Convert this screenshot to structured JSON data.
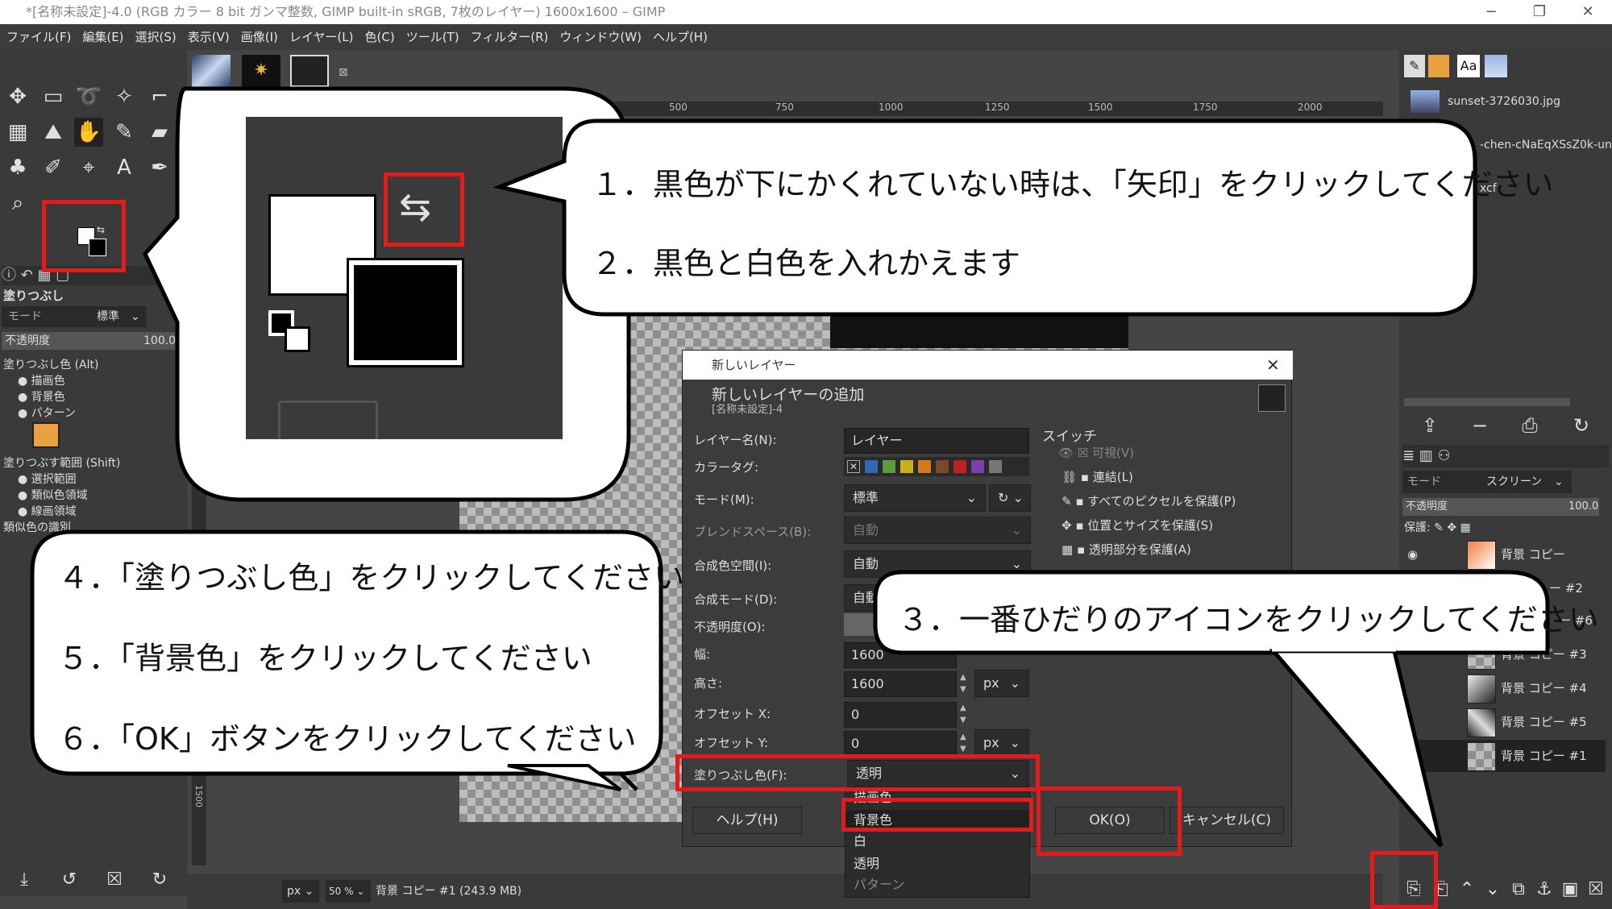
{
  "window": {
    "title": "*[名称未設定]-4.0 (RGB カラー 8 bit ガンマ整数, GIMP built-in sRGB, 7枚のレイヤー) 1600x1600 – GIMP",
    "controls": [
      "−",
      "❐",
      "✕"
    ]
  },
  "menu": [
    "ファイル(F)",
    "編集(E)",
    "選択(S)",
    "表示(V)",
    "画像(I)",
    "レイヤー(L)",
    "色(C)",
    "ツール(T)",
    "フィルター(R)",
    "ウィンドウ(W)",
    "ヘルプ(H)"
  ],
  "toolOptions": {
    "title": "塗りつぶし",
    "mode_label": "モード",
    "mode_value": "標準",
    "opacity_label": "不透明度",
    "opacity_value": "100.0",
    "fillcolor_label": "塗りつぶし色 (Alt)",
    "fill_options": [
      "描画色",
      "背景色",
      "パターン"
    ],
    "area_label": "塗りつぶす範囲 (Shift)",
    "area_options": [
      "選択範囲",
      "類似色領域",
      "線画領域"
    ],
    "similar_label": "類似色の識別"
  },
  "ruler": {
    "ticks": [
      "500",
      "750",
      "1000",
      "1250",
      "1500",
      "1750",
      "2000"
    ],
    "side": "1500"
  },
  "status": {
    "unit": "px",
    "zoom": "50 %",
    "layer_info": "背景 コピー #1 (243.9 MB)"
  },
  "rightPanel": {
    "images": [
      "sunset-3726030.jpg",
      "-chen-cNaEqXSsZ0k-unsp",
      "xcf"
    ],
    "layers_mode_label": "モード",
    "layers_mode_value": "スクリーン",
    "opacity_label": "不透明度",
    "opacity_value": "100.0",
    "lock_label": "保護:",
    "layers": [
      "背景 コピー",
      "ー #2",
      "ー #6",
      "背景 コピー #3",
      "背景 コピー #4",
      "背景 コピー #5",
      "背景 コピー #1"
    ]
  },
  "dialog": {
    "title": "新しいレイヤー",
    "heading": "新しいレイヤーの追加",
    "subheading": "[名称未設定]-4",
    "layer_name_label": "レイヤー名(N):",
    "layer_name_value": "レイヤー",
    "color_tag_label": "カラータグ:",
    "mode_label": "モード(M):",
    "mode_value": "標準",
    "blend_space_label": "ブレンドスペース(B):",
    "blend_space_value": "自動",
    "composite_space_label": "合成色空間(I):",
    "composite_space_value": "自動",
    "composite_mode_label": "合成モード(D):",
    "composite_mode_value": "自動",
    "opacity_label": "不透明度(O):",
    "width_label": "幅:",
    "width_value": "1600",
    "height_label": "高さ:",
    "height_value": "1600",
    "offset_x_label": "オフセット X:",
    "offset_x_value": "0",
    "offset_y_label": "オフセット Y:",
    "offset_y_value": "0",
    "unit": "px",
    "fill_label": "塗りつぶし色(F):",
    "fill_value": "透明",
    "fill_dropdown": [
      "描画色",
      "背景色",
      "白",
      "透明",
      "パターン"
    ],
    "switch_title": "スイッチ",
    "switches": [
      "可視(V)",
      "連結(L)",
      "すべてのピクセルを保護(P)",
      "位置とサイズを保護(S)",
      "透明部分を保護(A)"
    ],
    "help_button": "ヘルプ(H)",
    "ok_button": "OK(O)",
    "cancel_button": "キャンセル(C)"
  },
  "callouts": {
    "step1": "１．黒色が下にかくれていない時は、「矢印」をクリックしてください",
    "step2": "２．黒色と白色を入れかえます",
    "step3": "３．一番ひだりのアイコンをクリックしてください",
    "step4": "４．「塗りつぶし色」をクリックしてください",
    "step5": "５．「背景色」をクリックしてください",
    "step6": "６．「OK」ボタンをクリックしてください"
  },
  "colors": {
    "annotation_red": "#e41b1b",
    "panel": "#3a3a3a",
    "dialog": "#3c3c3c"
  }
}
